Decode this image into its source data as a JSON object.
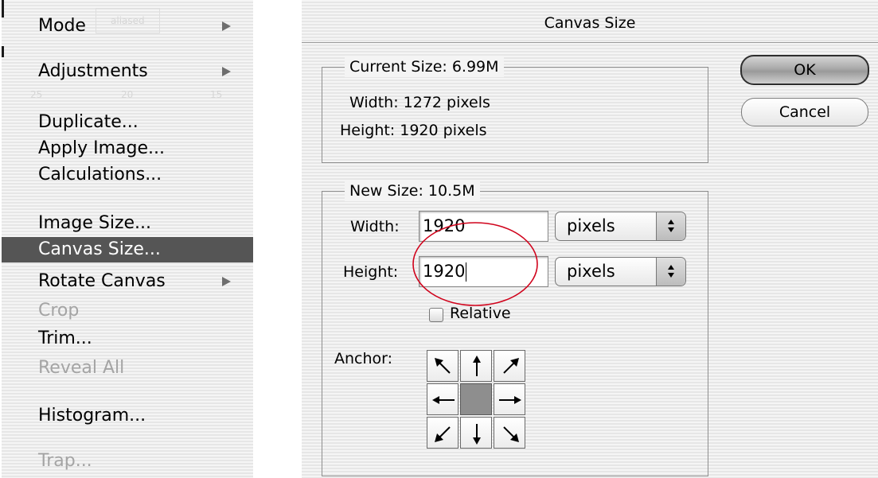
{
  "menu": {
    "items": [
      {
        "label": "Mode",
        "submenu": true,
        "state": "normal"
      },
      {
        "label": "Adjustments",
        "submenu": true,
        "state": "normal"
      },
      {
        "label": "Duplicate...",
        "submenu": false,
        "state": "normal"
      },
      {
        "label": "Apply Image...",
        "submenu": false,
        "state": "normal"
      },
      {
        "label": "Calculations...",
        "submenu": false,
        "state": "normal"
      },
      {
        "label": "Image Size...",
        "submenu": false,
        "state": "normal"
      },
      {
        "label": "Canvas Size...",
        "submenu": false,
        "state": "selected"
      },
      {
        "label": "Rotate Canvas",
        "submenu": true,
        "state": "normal"
      },
      {
        "label": "Crop",
        "submenu": false,
        "state": "disabled"
      },
      {
        "label": "Trim...",
        "submenu": false,
        "state": "normal"
      },
      {
        "label": "Reveal All",
        "submenu": false,
        "state": "disabled"
      },
      {
        "label": "Histogram...",
        "submenu": false,
        "state": "normal"
      },
      {
        "label": "Trap...",
        "submenu": false,
        "state": "disabled"
      }
    ],
    "background_text": {
      "aliased": "aliased",
      "ruler_labels": [
        "25",
        "20",
        "15"
      ]
    }
  },
  "dialog": {
    "title": "Canvas Size",
    "current_size": {
      "legend": "Current Size:  6.99M",
      "width": "Width: 1272 pixels",
      "height": "Height: 1920 pixels"
    },
    "new_size": {
      "legend": "New Size:  10.5M",
      "width_label": "Width:",
      "width_value": "1920",
      "width_unit": "pixels",
      "height_label": "Height:",
      "height_value": "1920",
      "height_unit": "pixels",
      "relative_label": "Relative",
      "relative_checked": false
    },
    "anchor": {
      "label": "Anchor:",
      "selected": "center",
      "icons": [
        "arrow-up-left-icon",
        "arrow-up-icon",
        "arrow-up-right-icon",
        "arrow-left-icon",
        "anchor-center",
        "arrow-right-icon",
        "arrow-down-left-icon",
        "arrow-down-icon",
        "arrow-down-right-icon"
      ]
    },
    "buttons": {
      "ok": "OK",
      "cancel": "Cancel"
    }
  },
  "annotation_color": "#d0021b"
}
